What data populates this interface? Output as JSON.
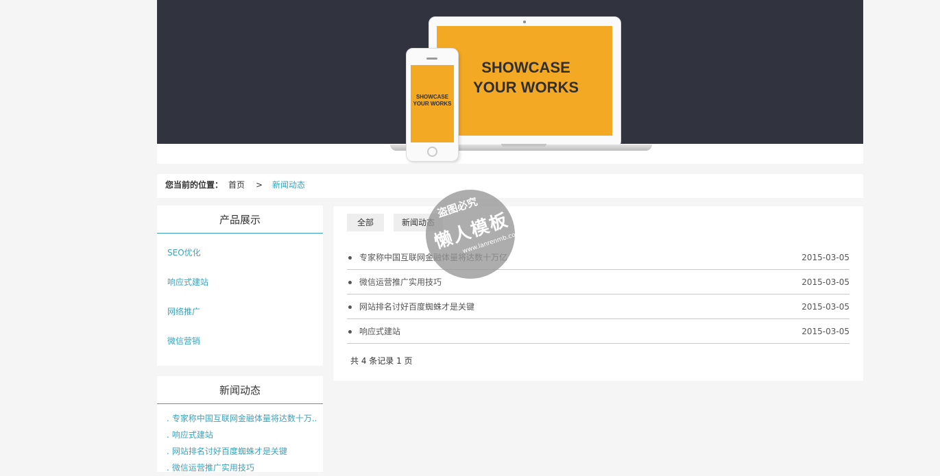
{
  "banner": {
    "laptop_text_line1": "SHOWCASE",
    "laptop_text_line2": "YOUR WORKS",
    "phone_text_line1": "SHOWCASE",
    "phone_text_line2": "YOUR WORKS",
    "accent_color": "#f4a924",
    "background_color": "#31333f"
  },
  "breadcrumb": {
    "label": "您当前的位置：",
    "home": "首页",
    "separator": ">",
    "current": "新闻动态"
  },
  "sidebar": {
    "products": {
      "title": "产品展示",
      "items": [
        {
          "label": "SEO优化"
        },
        {
          "label": "响应式建站"
        },
        {
          "label": "网络推广"
        },
        {
          "label": "微信营销"
        }
      ]
    },
    "news": {
      "title": "新闻动态",
      "bullet": ".",
      "items": [
        {
          "label": "专家称中国互联网金融体量将达数十万.."
        },
        {
          "label": "响应式建站"
        },
        {
          "label": "网站排名讨好百度蜘蛛才是关键"
        },
        {
          "label": "微信运营推广实用技巧"
        }
      ]
    }
  },
  "main": {
    "tabs": [
      {
        "label": "全部"
      },
      {
        "label": "新闻动态"
      }
    ],
    "articles": [
      {
        "title": "专家称中国互联网金融体量将达数十万亿",
        "date": "2015-03-05"
      },
      {
        "title": "微信运营推广实用技巧",
        "date": "2015-03-05"
      },
      {
        "title": "网站排名讨好百度蜘蛛才是关键",
        "date": "2015-03-05"
      },
      {
        "title": "响应式建站",
        "date": "2015-03-05"
      }
    ],
    "pager": "共 4 条记录 1 页"
  },
  "watermark": {
    "line1": "盗图必究",
    "line2": "懒人模板",
    "url": "www.lanrenmb.com"
  },
  "colors": {
    "link": "#3aa4bc",
    "page_background": "#f5f5f5"
  }
}
